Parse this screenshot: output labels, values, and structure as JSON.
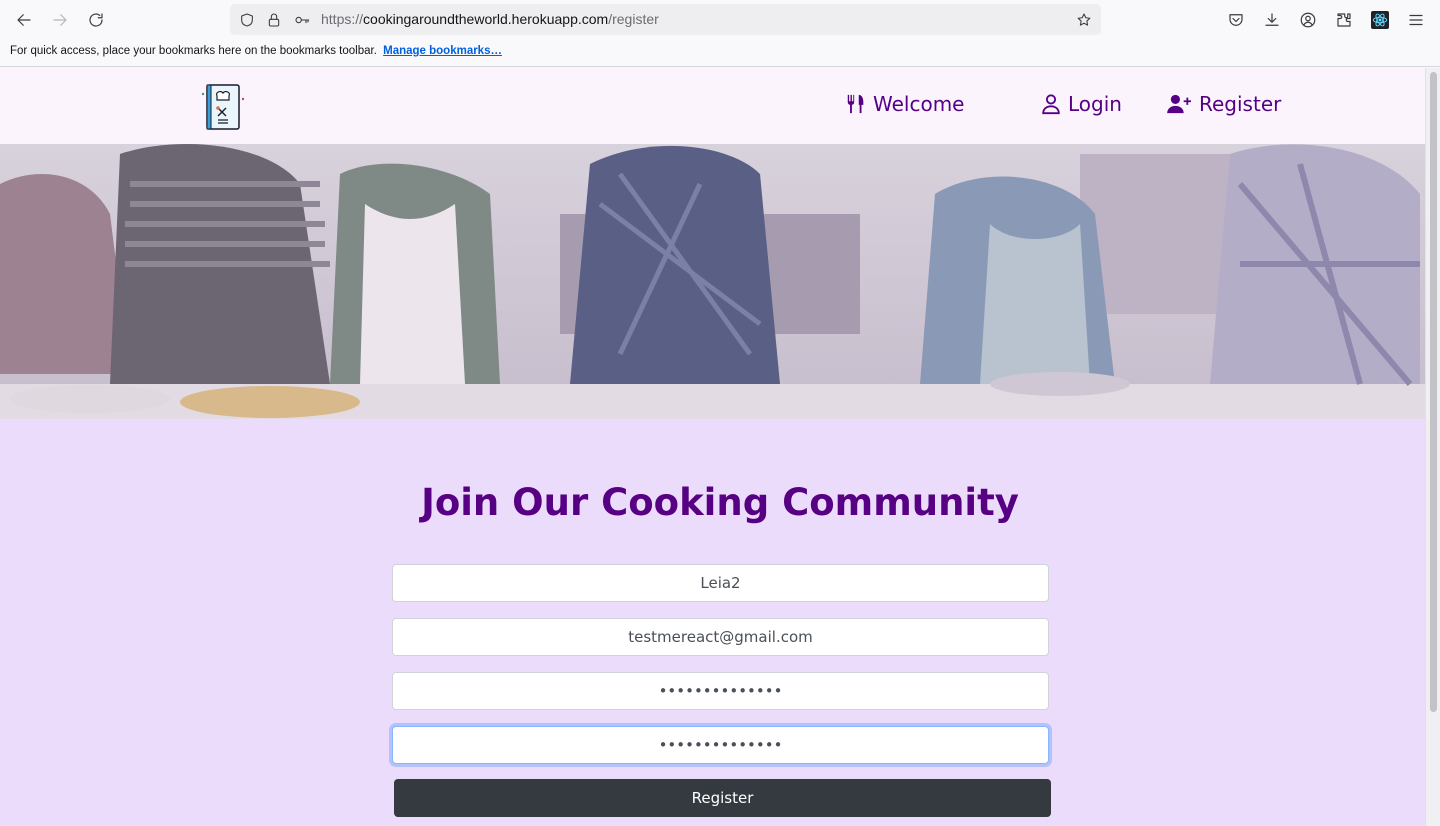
{
  "browser": {
    "url_prefix": "https://",
    "url_host": "cookingaroundtheworld.herokuapp.com",
    "url_path": "/register",
    "bookmarks_message": "For quick access, place your bookmarks here on the bookmarks toolbar.",
    "manage_bookmarks": "Manage bookmarks…"
  },
  "nav": {
    "welcome": "Welcome",
    "login": "Login",
    "register": "Register"
  },
  "page": {
    "heading": "Join Our Cooking Community"
  },
  "form": {
    "username": "Leia2",
    "email": "testmereact@gmail.com",
    "password": "••••••••••••••",
    "password_confirm": "••••••••••••••",
    "submit": "Register"
  }
}
